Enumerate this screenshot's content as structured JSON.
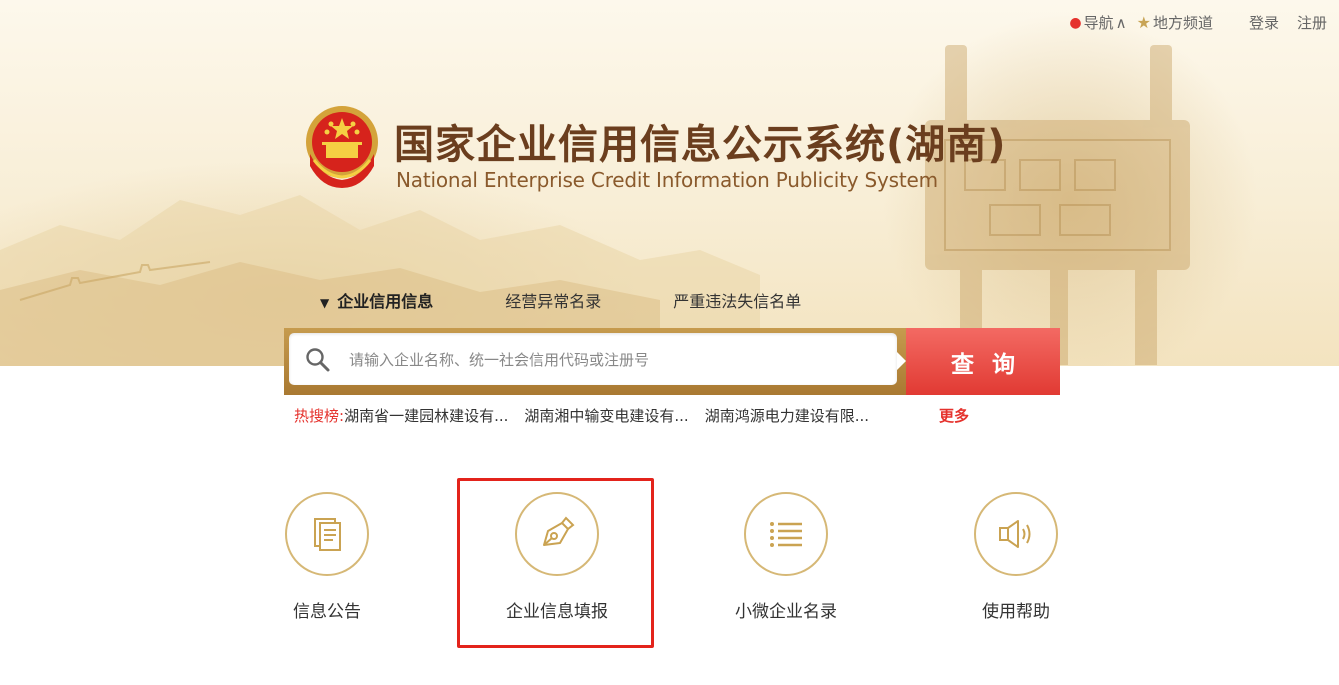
{
  "topnav": {
    "nav_label": "导航",
    "nav_caret": "∧",
    "local_label": "地方频道",
    "login_label": "登录",
    "register_label": "注册"
  },
  "header": {
    "title_cn": "国家企业信用信息公示系统(湖南)",
    "title_en": "National Enterprise Credit Information Publicity System"
  },
  "tabs": [
    {
      "label": "企业信用信息",
      "active": true
    },
    {
      "label": "经营异常名录",
      "active": false
    },
    {
      "label": "严重违法失信名单",
      "active": false
    }
  ],
  "search": {
    "placeholder": "请输入企业名称、统一社会信用代码或注册号",
    "button_label": "查询"
  },
  "hot": {
    "label": "热搜榜:",
    "items": [
      "湖南省一建园林建设有...",
      "湖南湘中输变电建设有...",
      "湖南鸿源电力建设有限..."
    ],
    "more_label": "更多"
  },
  "services": [
    {
      "label": "信息公告",
      "icon": "document-icon"
    },
    {
      "label": "企业信息填报",
      "icon": "pen-icon"
    },
    {
      "label": "小微企业名录",
      "icon": "list-icon"
    },
    {
      "label": "使用帮助",
      "icon": "speaker-icon"
    }
  ],
  "colors": {
    "accent_red": "#e5322d",
    "gold": "#d6b876",
    "title_brown": "#6b3e1e",
    "highlight_border": "#e3231b"
  }
}
